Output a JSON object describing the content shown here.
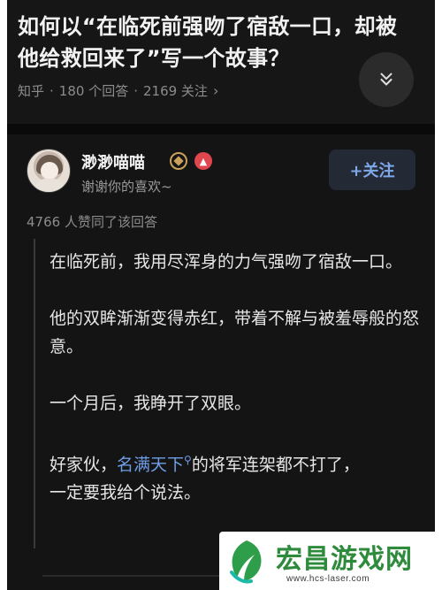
{
  "question": {
    "title": "如何以“在临死前强吻了宿敌一口，却被他给救回来了”写一个故事？",
    "meta_source": "知乎",
    "meta_answers": "180 个回答",
    "meta_followers": "2169 关注",
    "meta_sep": "·"
  },
  "author": {
    "name": "渺渺喵喵",
    "bio": "谢谢你的喜欢~",
    "follow_label": "+关注",
    "badge2_text": "▲"
  },
  "answer": {
    "likes": "4766 人赞同了该回答",
    "paragraphs": [
      "在临死前，我用尽浑身的力气强吻了宿敌一口。",
      "他的双眸渐渐变得赤红，带着不解与被羞辱般的怒意。",
      "一个月后，我睁开了双眼。"
    ],
    "p4_prefix": "好家伙，",
    "p4_link": "名满天下",
    "p4_suffix": "的将军连架都不打了，",
    "p4_line2": "一定要我给个说法。"
  },
  "watermark": {
    "title": "宏昌游戏网",
    "url": "www.hcs-laser.com"
  },
  "icons": {
    "expand": "double-chevron-down-icon",
    "meta_arrow": "chevron-right-icon",
    "search": "search-icon"
  },
  "colors": {
    "background": "#121212",
    "link": "#6f9ee8",
    "follow": "#7fa8ea",
    "watermark_green": "#2e8b3c"
  }
}
